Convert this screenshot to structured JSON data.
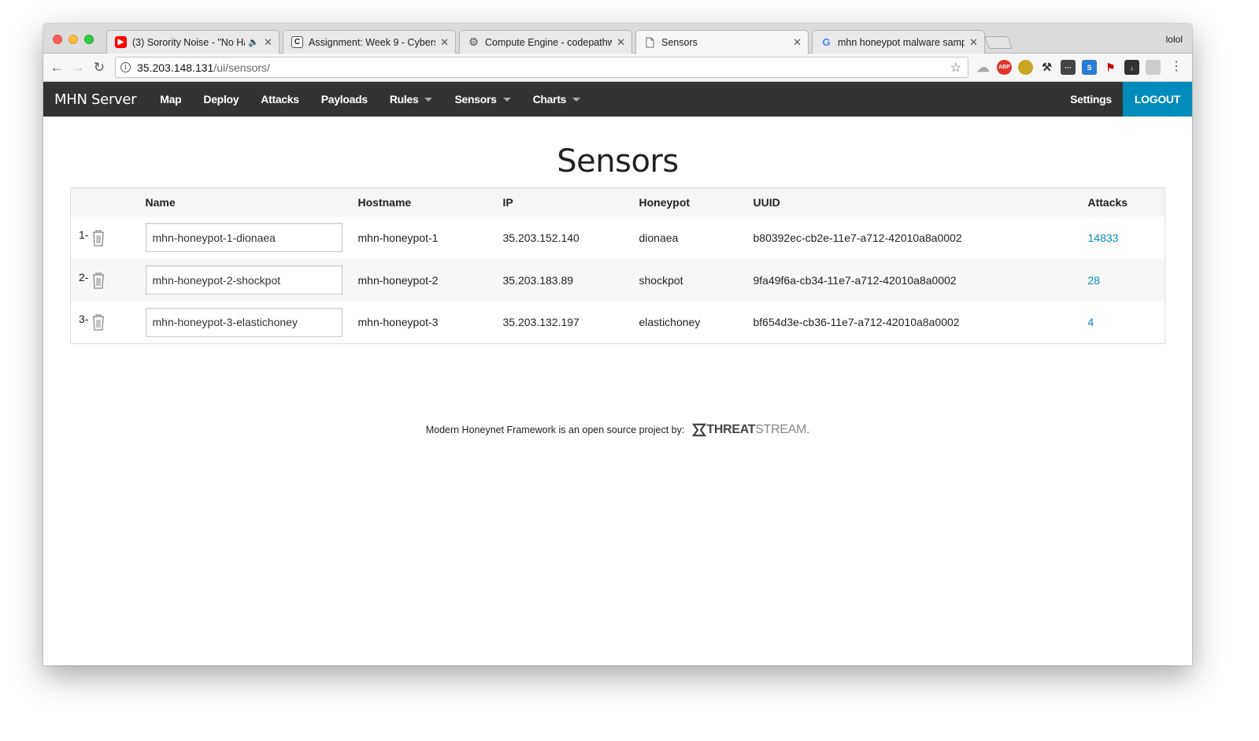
{
  "browser": {
    "tabs": [
      {
        "title": "(3) Sorority Noise - \"No Hal",
        "favicon": "youtube-icon",
        "muted": true
      },
      {
        "title": "Assignment: Week 9 - Cyberse",
        "favicon": "codepath-icon"
      },
      {
        "title": "Compute Engine - codepathwe",
        "favicon": "gcp-icon"
      },
      {
        "title": "Sensors",
        "favicon": "page-icon"
      },
      {
        "title": "mhn honeypot malware sample",
        "favicon": "google-icon"
      }
    ],
    "profile": "lolol",
    "url_host": "35.203.148.131",
    "url_path": "/ui/sensors/"
  },
  "navbar": {
    "brand": "MHN Server",
    "items": [
      "Map",
      "Deploy",
      "Attacks",
      "Payloads",
      "Rules",
      "Sensors",
      "Charts"
    ],
    "settings": "Settings",
    "logout": "LOGOUT"
  },
  "page": {
    "title": "Sensors"
  },
  "table": {
    "headers": [
      "Name",
      "Hostname",
      "IP",
      "Honeypot",
      "UUID",
      "Attacks"
    ],
    "rows": [
      {
        "idx": "1-",
        "name": "mhn-honeypot-1-dionaea",
        "hostname": "mhn-honeypot-1",
        "ip": "35.203.152.140",
        "honeypot": "dionaea",
        "uuid": "b80392ec-cb2e-11e7-a712-42010a8a0002",
        "attacks": "14833"
      },
      {
        "idx": "2-",
        "name": "mhn-honeypot-2-shockpot",
        "hostname": "mhn-honeypot-2",
        "ip": "35.203.183.89",
        "honeypot": "shockpot",
        "uuid": "9fa49f6a-cb34-11e7-a712-42010a8a0002",
        "attacks": "28"
      },
      {
        "idx": "3-",
        "name": "mhn-honeypot-3-elastichoney",
        "hostname": "mhn-honeypot-3",
        "ip": "35.203.132.197",
        "honeypot": "elastichoney",
        "uuid": "bf654d3e-cb36-11e7-a712-42010a8a0002",
        "attacks": "4"
      }
    ]
  },
  "footer": {
    "text": "Modern Honeynet Framework is an open source project by:",
    "logo_bold": "THREAT",
    "logo_light": "STREAM."
  },
  "colors": {
    "navbar_bg": "#333333",
    "accent": "#008cba",
    "youtube_red": "#ff0000"
  }
}
